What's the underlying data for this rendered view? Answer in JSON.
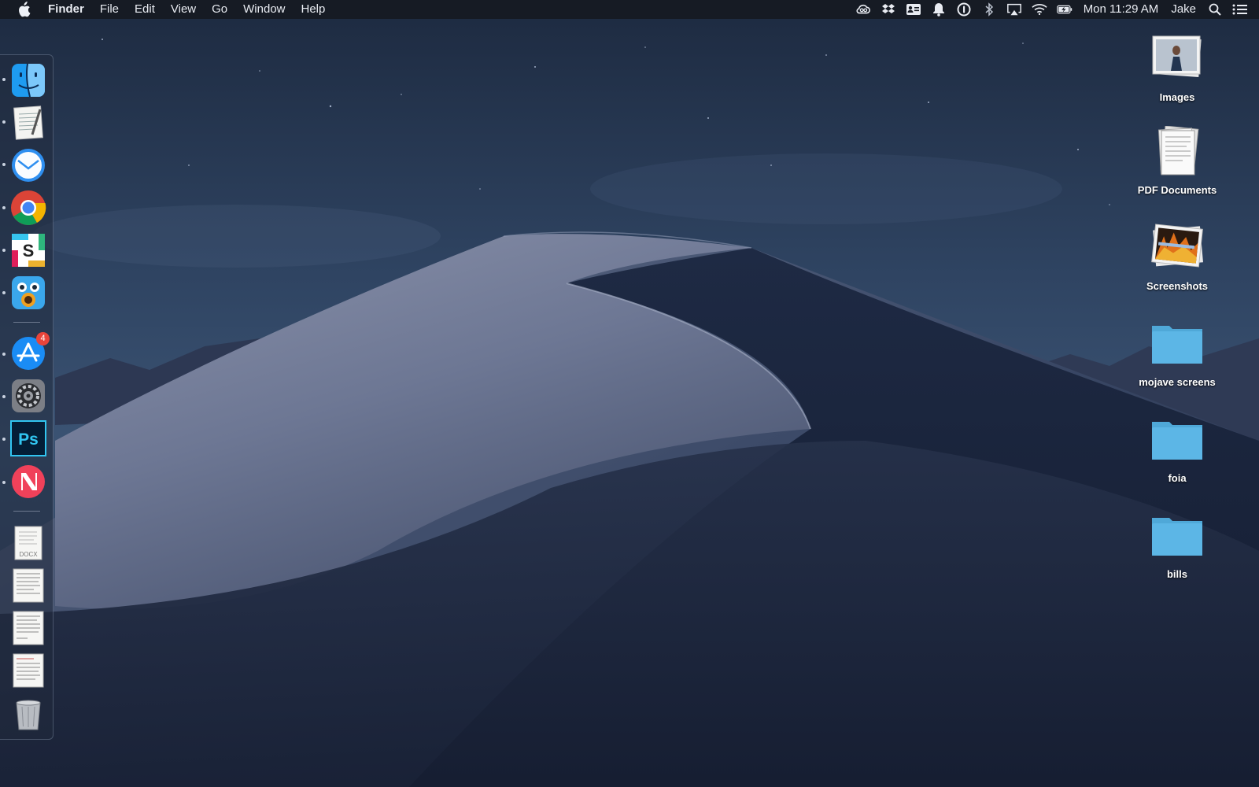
{
  "menubar": {
    "apple_icon": "apple-logo-icon",
    "app_name": "Finder",
    "menus": [
      "File",
      "Edit",
      "View",
      "Go",
      "Window",
      "Help"
    ],
    "status_icons": [
      "creative-cloud-icon",
      "dropbox-icon",
      "contact-card-icon",
      "notification-bell-icon",
      "1password-icon",
      "bluetooth-icon",
      "airplay-icon",
      "wifi-icon",
      "battery-charging-icon"
    ],
    "clock": "Mon 11:29 AM",
    "user": "Jake",
    "spotlight_icon": "search-icon",
    "notification_center_icon": "list-icon"
  },
  "dock": {
    "apps": [
      {
        "name": "Finder",
        "icon": "finder-icon"
      },
      {
        "name": "TextEdit",
        "icon": "textedit-icon"
      },
      {
        "name": "Airmail",
        "icon": "airmail-icon"
      },
      {
        "name": "Google Chrome",
        "icon": "chrome-icon"
      },
      {
        "name": "Slack",
        "icon": "slack-icon"
      },
      {
        "name": "Tweetbot",
        "icon": "tweetbot-icon"
      },
      {
        "name": "App Store",
        "icon": "app-store-icon",
        "badge": "4"
      },
      {
        "name": "System Preferences",
        "icon": "system-preferences-icon"
      },
      {
        "name": "Photoshop",
        "icon": "photoshop-icon",
        "glyph": "Ps"
      },
      {
        "name": "News",
        "icon": "news-icon"
      }
    ],
    "docx_label": "DOCX",
    "documents": [
      "document-icon",
      "document-icon",
      "document-icon",
      "document-icon"
    ],
    "trash": "trash-icon"
  },
  "desktop": {
    "items": [
      {
        "label": "Images",
        "icon": "image-stack-icon"
      },
      {
        "label": "PDF Documents",
        "icon": "pdf-stack-icon"
      },
      {
        "label": "Screenshots",
        "icon": "screenshot-stack-icon"
      },
      {
        "label": "mojave screens",
        "icon": "folder-icon"
      },
      {
        "label": "foia",
        "icon": "folder-icon"
      },
      {
        "label": "bills",
        "icon": "folder-icon"
      }
    ]
  },
  "colors": {
    "folder": "#5cb6e6",
    "badge": "#e9443a",
    "menubar": "#161a22"
  }
}
